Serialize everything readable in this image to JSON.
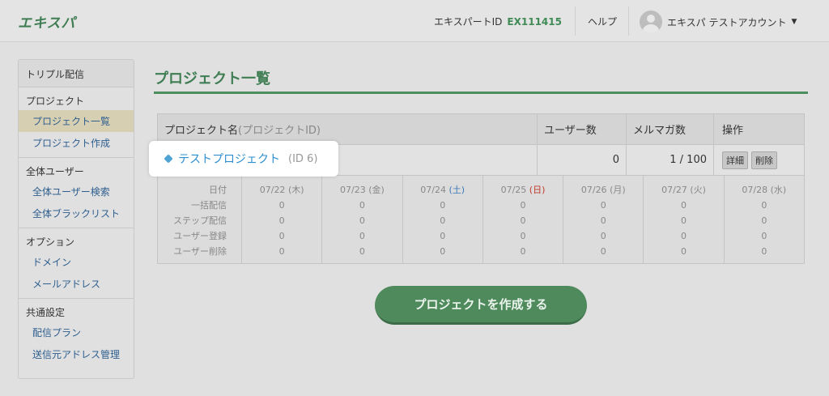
{
  "header": {
    "logo": "エキスパ",
    "id_label": "エキスパートID",
    "id_value": "EX111415",
    "help": "ヘルプ",
    "user_name": "エキスパ テストアカウント"
  },
  "sidebar": {
    "top": "トリプル配信",
    "sections": [
      {
        "head": "プロジェクト",
        "items": [
          "プロジェクト一覧",
          "プロジェクト作成"
        ]
      },
      {
        "head": "全体ユーザー",
        "items": [
          "全体ユーザー検索",
          "全体ブラックリスト"
        ]
      },
      {
        "head": "オプション",
        "items": [
          "ドメイン",
          "メールアドレス"
        ]
      },
      {
        "head": "共通設定",
        "items": [
          "配信プラン",
          "送信元アドレス管理"
        ]
      }
    ]
  },
  "main": {
    "title": "プロジェクト一覧",
    "table": {
      "headers": {
        "name": "プロジェクト名",
        "name_sub": "(プロジェクトID)",
        "users": "ユーザー数",
        "mailmag": "メルマガ数",
        "ops": "操作"
      },
      "row": {
        "name": "テストプロジェクト",
        "id": "(ID 6)",
        "users": "0",
        "mailmag": "1 / 100",
        "detail": "詳細",
        "delete": "削除"
      }
    },
    "stats": {
      "row_labels": [
        "日付",
        "一括配信",
        "ステップ配信",
        "ユーザー登録",
        "ユーザー削除"
      ],
      "columns": [
        {
          "date": "07/22",
          "day": "(木)",
          "values": [
            "0",
            "0",
            "0",
            "0"
          ]
        },
        {
          "date": "07/23",
          "day": "(金)",
          "values": [
            "0",
            "0",
            "0",
            "0"
          ]
        },
        {
          "date": "07/24",
          "day": "(土)",
          "values": [
            "0",
            "0",
            "0",
            "0"
          ]
        },
        {
          "date": "07/25",
          "day": "(日)",
          "values": [
            "0",
            "0",
            "0",
            "0"
          ]
        },
        {
          "date": "07/26",
          "day": "(月)",
          "values": [
            "0",
            "0",
            "0",
            "0"
          ]
        },
        {
          "date": "07/27",
          "day": "(火)",
          "values": [
            "0",
            "0",
            "0",
            "0"
          ]
        },
        {
          "date": "07/28",
          "day": "(水)",
          "values": [
            "0",
            "0",
            "0",
            "0"
          ]
        }
      ]
    },
    "create_button": "プロジェクトを作成する"
  }
}
